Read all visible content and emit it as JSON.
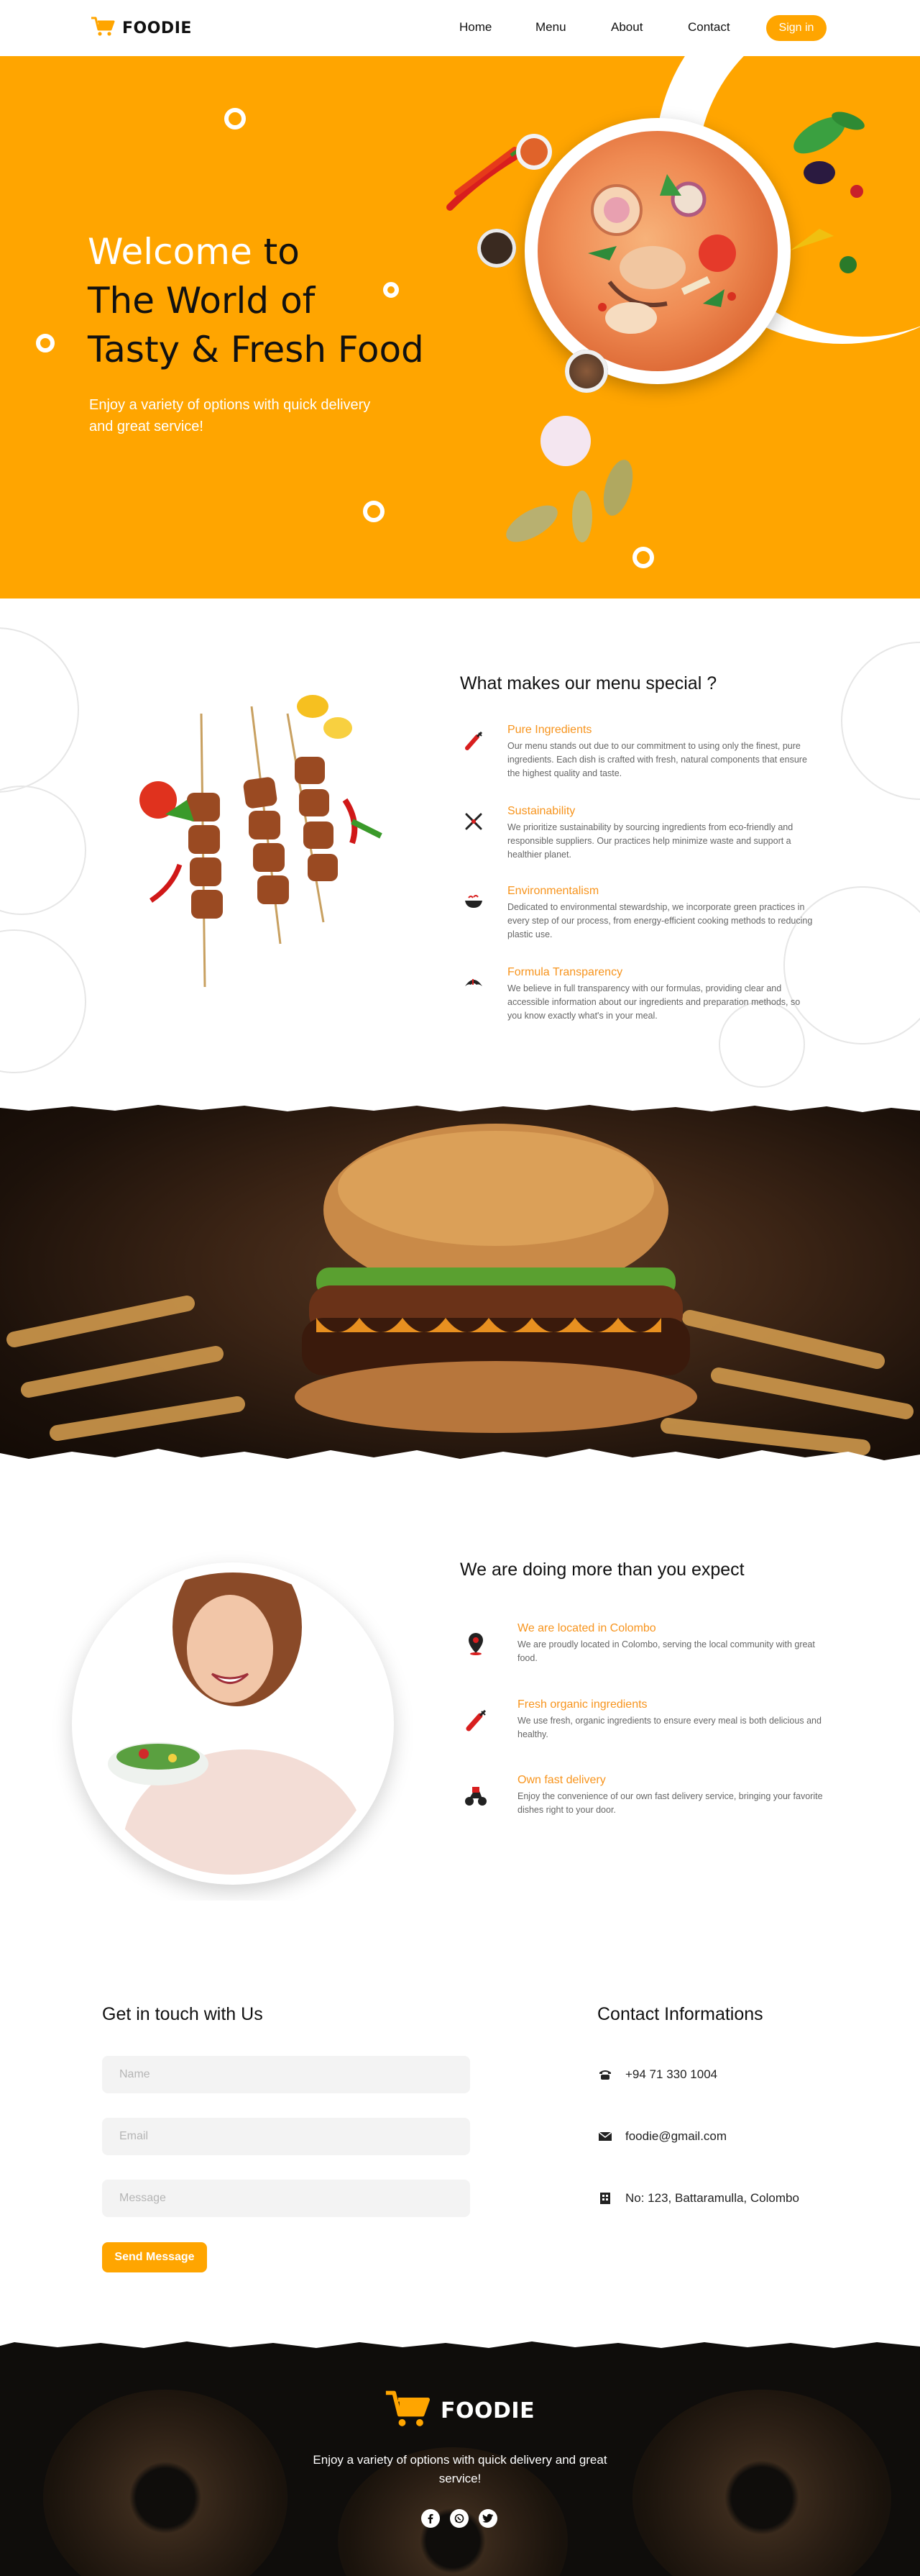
{
  "nav": {
    "brand": "FOODIE",
    "links": [
      "Home",
      "Menu",
      "About",
      "Contact"
    ],
    "signin": "Sign in"
  },
  "hero": {
    "title_white": "Welcome",
    "title_rest1": " to",
    "title_line2": "The World of",
    "title_line3": "Tasty & Fresh Food",
    "subtitle": "Enjoy a variety of options with quick delivery and great service!"
  },
  "special": {
    "title": "What makes our menu special ?",
    "features": [
      {
        "title": "Pure Ingredients",
        "desc": "Our menu stands out due to our commitment to using only the finest, pure ingredients. Each dish is crafted with fresh, natural components that ensure the highest quality and taste.",
        "icon": "pepper-icon"
      },
      {
        "title": "Sustainability",
        "desc": "We prioritize sustainability by sourcing ingredients from eco-friendly and responsible suppliers. Our practices help minimize waste and support a healthier planet.",
        "icon": "fork-knife-icon"
      },
      {
        "title": "Environmentalism",
        "desc": "Dedicated to environmental stewardship, we incorporate green practices in every step of our process, from energy-efficient cooking methods to reducing plastic use.",
        "icon": "wok-icon"
      },
      {
        "title": "Formula Transparency",
        "desc": "We believe in full transparency with our formulas, providing clear and accessible information about our ingredients and preparation methods, so you know exactly what's in your meal.",
        "icon": "croissant-icon"
      }
    ]
  },
  "more": {
    "title": "We are doing more than you expect",
    "items": [
      {
        "title": "We are located in Colombo",
        "desc": "We are proudly located in Colombo, serving the local community with great food.",
        "icon": "location-pin-icon"
      },
      {
        "title": "Fresh organic ingredients",
        "desc": "We use fresh, organic ingredients to ensure every meal is both delicious and healthy.",
        "icon": "pepper-icon"
      },
      {
        "title": "Own fast delivery",
        "desc": "Enjoy the convenience of our own fast delivery service, bringing your favorite dishes right to your door.",
        "icon": "scooter-icon"
      }
    ]
  },
  "contact": {
    "form_title": "Get in touch with Us",
    "name_placeholder": "Name",
    "email_placeholder": "Email",
    "message_placeholder": "Message",
    "send": "Send Message",
    "info_title": "Contact Informations",
    "phone": "+94 71 330 1004",
    "email": "foodie@gmail.com",
    "address": "No: 123, Battaramulla, Colombo"
  },
  "footer": {
    "brand": "FOODIE",
    "desc": "Enjoy a variety of options with quick delivery and great service!",
    "socials": [
      "facebook-icon",
      "whatsapp-icon",
      "twitter-icon"
    ]
  },
  "colors": {
    "accent": "#ffa500",
    "feature_title": "#f7941d"
  }
}
